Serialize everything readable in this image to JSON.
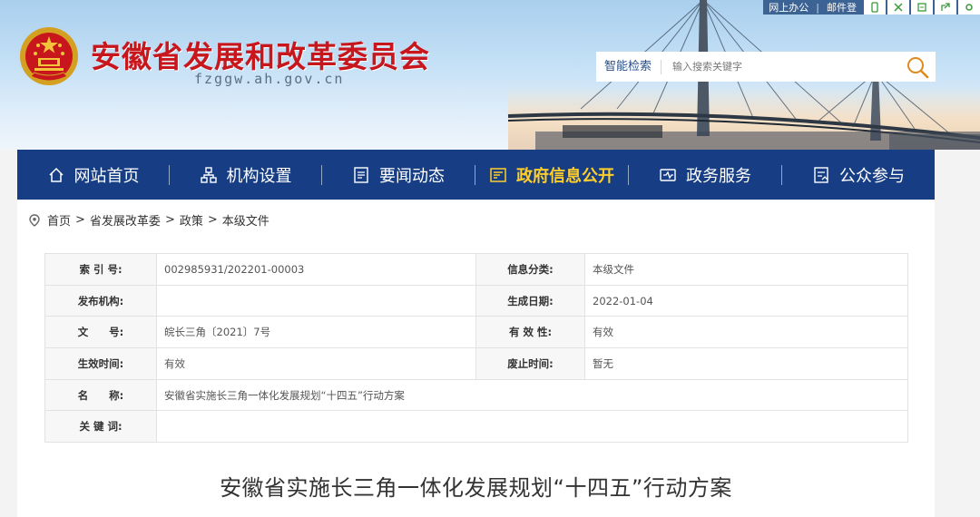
{
  "header": {
    "site_title": "安徽省发展和改革委员会",
    "site_domain": "fzggw.ah.gov.cn",
    "topbar": {
      "links": [
        "网上办公",
        "邮件登"
      ],
      "icons": [
        "mobile-icon",
        "network-icon",
        "archive-icon",
        "share-icon",
        "settings-icon"
      ]
    },
    "search": {
      "label": "智能检索",
      "placeholder": "输入搜索关键字"
    }
  },
  "nav": {
    "items": [
      {
        "label": "网站首页",
        "icon": "home-icon",
        "active": false
      },
      {
        "label": "机构设置",
        "icon": "org-chart-icon",
        "active": false
      },
      {
        "label": "要闻动态",
        "icon": "news-icon",
        "active": false
      },
      {
        "label": "政府信息公开",
        "icon": "info-open-icon",
        "active": true
      },
      {
        "label": "政务服务",
        "icon": "service-icon",
        "active": false
      },
      {
        "label": "公众参与",
        "icon": "participate-icon",
        "active": false
      }
    ]
  },
  "breadcrumb": {
    "items": [
      "首页",
      "省发展改革委",
      "政策",
      "本级文件"
    ],
    "separator": ">"
  },
  "info_table": {
    "rows": [
      {
        "k1": "索 引 号:",
        "v1": "002985931/202201-00003",
        "k2": "信息分类:",
        "v2": "本级文件"
      },
      {
        "k1": "发布机构:",
        "v1": "",
        "k2": "生成日期:",
        "v2": "2022-01-04"
      },
      {
        "k1": "文　　号:",
        "v1": "皖长三角〔2021〕7号",
        "k2": "有 效 性:",
        "v2": "有效"
      },
      {
        "k1": "生效时间:",
        "v1": "有效",
        "k2": "废止时间:",
        "v2": "暂无"
      },
      {
        "k1": "名　　称:",
        "v1": "安徽省实施长三角一体化发展规划“十四五”行动方案"
      },
      {
        "k1": "关 键 词:",
        "v1": ""
      }
    ]
  },
  "document": {
    "title": "安徽省实施长三角一体化发展规划“十四五”行动方案"
  },
  "colors": {
    "nav_bg": "#173e84",
    "title_red": "#c8161d",
    "nav_active": "#ffce2b"
  }
}
